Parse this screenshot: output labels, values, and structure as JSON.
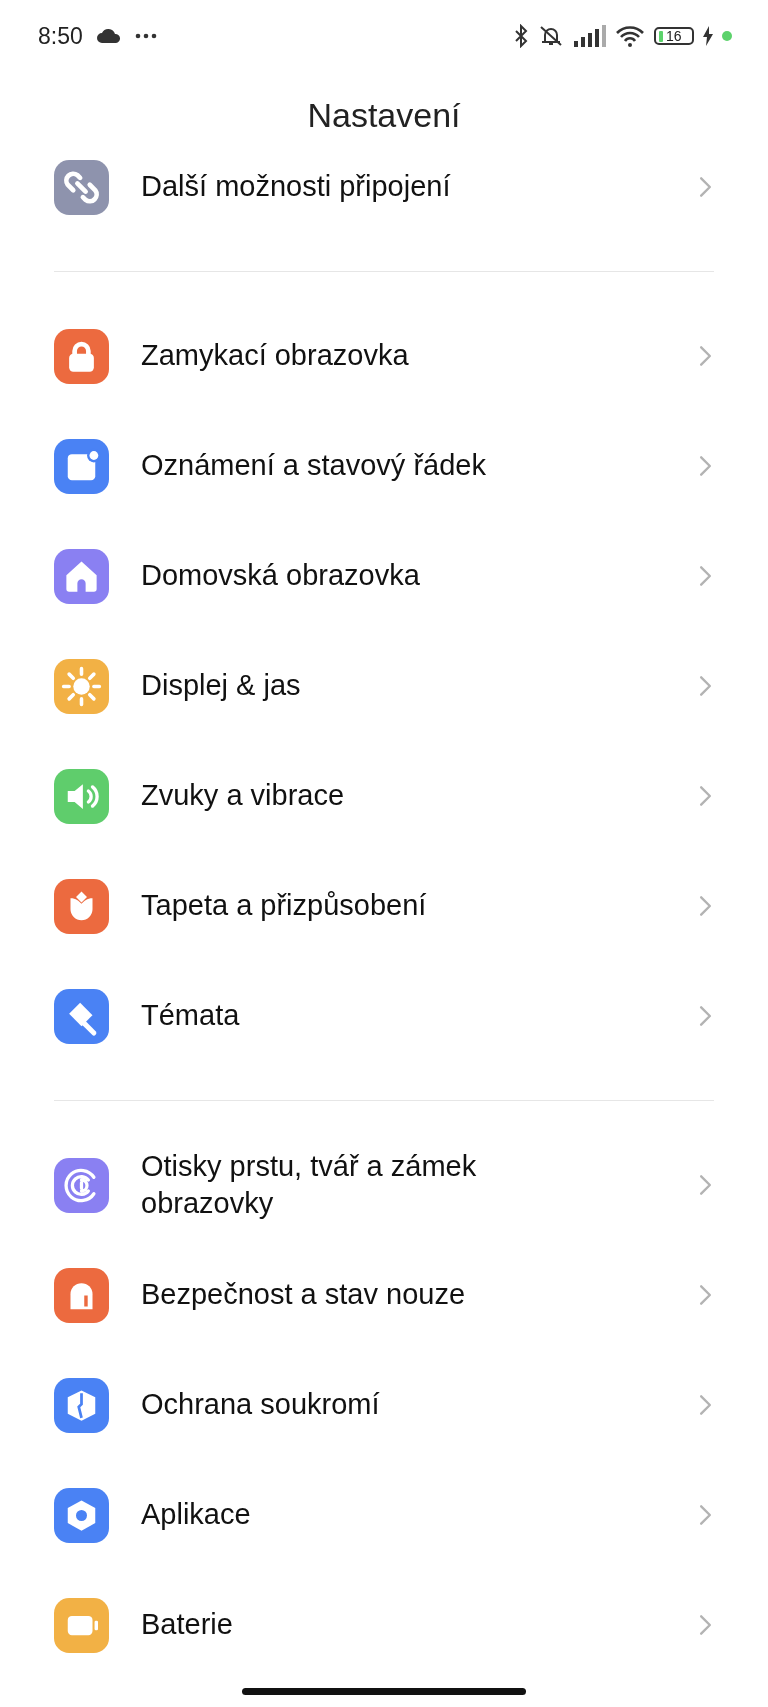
{
  "status_bar": {
    "time": "8:50",
    "battery": "16"
  },
  "title": "Nastavení",
  "groups": [
    {
      "items": [
        {
          "label": "Další možnosti připojení",
          "kind": "link",
          "color": "#8e93ad"
        }
      ]
    },
    {
      "items": [
        {
          "label": "Zamykací obrazovka",
          "kind": "lock",
          "color": "#ec6a3f"
        },
        {
          "label": "Oznámení a stavový řádek",
          "kind": "notification",
          "color": "#4a82f4"
        },
        {
          "label": "Domovská obrazovka",
          "kind": "home",
          "color": "#8a80f2"
        },
        {
          "label": "Displej & jas",
          "kind": "sun",
          "color": "#f2b145"
        },
        {
          "label": "Zvuky a vibrace",
          "kind": "sound",
          "color": "#5fcd6c"
        },
        {
          "label": "Tapeta a přizpůsobení",
          "kind": "tulip",
          "color": "#ec6a3f"
        },
        {
          "label": "Témata",
          "kind": "brush",
          "color": "#4a82f4"
        }
      ]
    },
    {
      "items": [
        {
          "label": "Otisky prstu, tvář a zámek obrazovky",
          "kind": "fingerprint",
          "color": "#8a80f2"
        },
        {
          "label": "Bezpečnost a stav nouze",
          "kind": "alarm",
          "color": "#ec6a3f"
        },
        {
          "label": "Ochrana soukromí",
          "kind": "shield",
          "color": "#4a82f4"
        },
        {
          "label": "Aplikace",
          "kind": "hexagon",
          "color": "#4a82f4"
        },
        {
          "label": "Baterie",
          "kind": "battery",
          "color": "#f2b145"
        }
      ]
    }
  ]
}
